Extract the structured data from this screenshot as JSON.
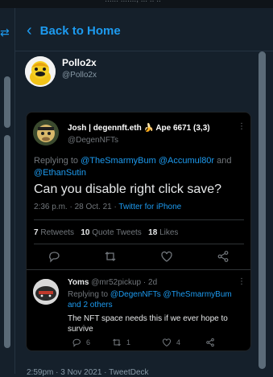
{
  "topstrip": {
    "text": "~~~ ...... ......., ... .. .."
  },
  "header": {
    "back_label": "Back to Home"
  },
  "profile": {
    "display_name": "Pollo2x",
    "handle": "@Pollo2x"
  },
  "quoted_tweet": {
    "author_name": "Josh | degennft.eth 🍌 Ape 6671 (3,3)",
    "author_handle": "@DegenNFTs",
    "replying_prefix": "Replying to ",
    "mention_1": "@TheSmarmyBum",
    "mention_2": "@Accumul80r",
    "conj": " and ",
    "mention_3": "@EthanSutin",
    "text": "Can you disable right click save?",
    "time": "2:36 p.m. · 28 Oct. 21 · ",
    "source": "Twitter for iPhone",
    "stats": {
      "retweets_count": "7",
      "retweets_label": "Retweets",
      "quotes_count": "10",
      "quotes_label": "Quote Tweets",
      "likes_count": "18",
      "likes_label": "Likes"
    },
    "more": "⋮"
  },
  "reply": {
    "author_name": "Yoms",
    "meta": " @mr52pickup · 2d",
    "replying_prefix": "Replying to ",
    "mention_1": "@DegenNFTs",
    "mention_2": "@TheSmarmyBum",
    "and_others": "and 2 others",
    "text": "The NFT space needs this if we ever hope to survive",
    "reply_count": "6",
    "retweet_count": "1",
    "like_count": "4",
    "more": "⋮"
  },
  "footer": {
    "text": "2:59pm · 3 Nov 2021 · TweetDeck"
  },
  "colors": {
    "background": "#15202b",
    "accent": "#1d9bf0",
    "card": "#000000",
    "muted": "#71767b"
  }
}
